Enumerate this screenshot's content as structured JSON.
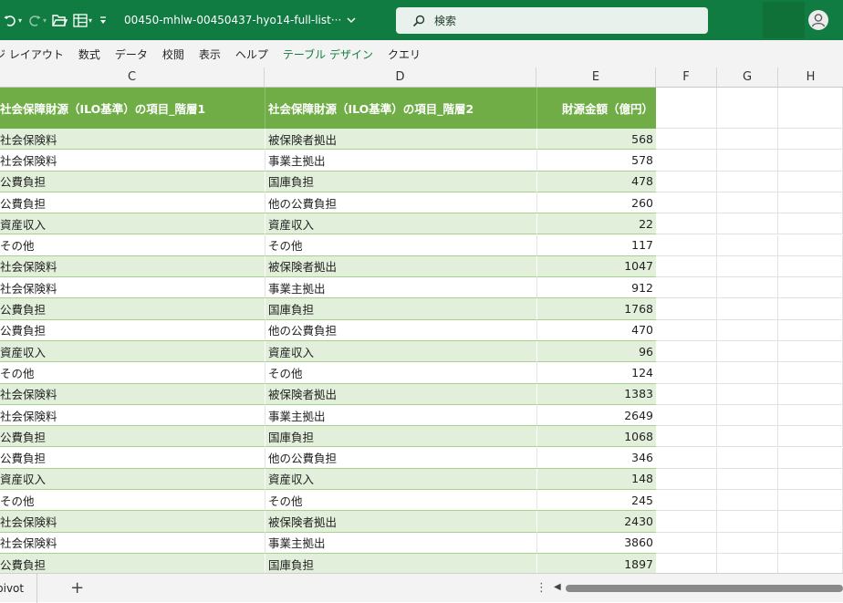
{
  "titlebar": {
    "undo_icon": "undo-icon",
    "redo_icon": "redo-icon",
    "open_icon": "open-folder-icon",
    "layout_icon": "table-layout-icon",
    "customize_icon": "customize-toolbar-icon",
    "filename": "00450-mhlw-00450437-hyo14-full-list···",
    "search_placeholder": "検索",
    "accent": "#107c41"
  },
  "ribbon": {
    "tabs": [
      {
        "label": "ジ レイアウト",
        "context": false
      },
      {
        "label": "数式",
        "context": false
      },
      {
        "label": "データ",
        "context": false
      },
      {
        "label": "校閲",
        "context": false
      },
      {
        "label": "表示",
        "context": false
      },
      {
        "label": "ヘルプ",
        "context": false
      },
      {
        "label": "テーブル デザイン",
        "context": true
      },
      {
        "label": "クエリ",
        "context": false
      }
    ]
  },
  "columns": [
    "C",
    "D",
    "E",
    "F",
    "G",
    "H"
  ],
  "table": {
    "header_color": "#70ad47",
    "band_color": "#e2efda",
    "headers": {
      "c": "社会保障財源（ILO基準）の項目_階層1",
      "d": "社会保障財源（ILO基準）の項目_階層2",
      "e": "財源金額（億円）"
    },
    "rows": [
      {
        "c": "社会保険料",
        "d": "被保険者拠出",
        "e": "568"
      },
      {
        "c": "社会保険料",
        "d": "事業主拠出",
        "e": "578"
      },
      {
        "c": "公費負担",
        "d": "国庫負担",
        "e": "478"
      },
      {
        "c": "公費負担",
        "d": "他の公費負担",
        "e": "260"
      },
      {
        "c": "資産収入",
        "d": "資産収入",
        "e": "22"
      },
      {
        "c": "その他",
        "d": "その他",
        "e": "117"
      },
      {
        "c": "社会保険料",
        "d": "被保険者拠出",
        "e": "1047"
      },
      {
        "c": "社会保険料",
        "d": "事業主拠出",
        "e": "912"
      },
      {
        "c": "公費負担",
        "d": "国庫負担",
        "e": "1768"
      },
      {
        "c": "公費負担",
        "d": "他の公費負担",
        "e": "470"
      },
      {
        "c": "資産収入",
        "d": "資産収入",
        "e": "96"
      },
      {
        "c": "その他",
        "d": "その他",
        "e": "124"
      },
      {
        "c": "社会保険料",
        "d": "被保険者拠出",
        "e": "1383"
      },
      {
        "c": "社会保険料",
        "d": "事業主拠出",
        "e": "2649"
      },
      {
        "c": "公費負担",
        "d": "国庫負担",
        "e": "1068"
      },
      {
        "c": "公費負担",
        "d": "他の公費負担",
        "e": "346"
      },
      {
        "c": "資産収入",
        "d": "資産収入",
        "e": "148"
      },
      {
        "c": "その他",
        "d": "その他",
        "e": "245"
      },
      {
        "c": "社会保険料",
        "d": "被保険者拠出",
        "e": "2430"
      },
      {
        "c": "社会保険料",
        "d": "事業主拠出",
        "e": "3860"
      },
      {
        "c": "公費負担",
        "d": "国庫負担",
        "e": "1897"
      }
    ]
  },
  "sheets": {
    "active": "pivot",
    "add_label": "+",
    "more_label": "⋮",
    "scroll_left": "◀"
  }
}
